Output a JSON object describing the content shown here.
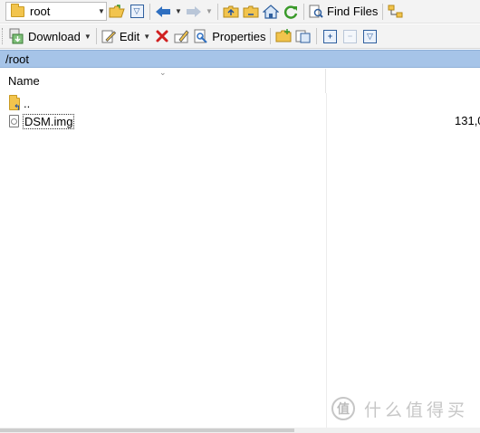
{
  "toolbar1": {
    "location": "root",
    "find_files": "Find Files"
  },
  "toolbar2": {
    "download": "Download",
    "edit": "Edit",
    "properties": "Properties"
  },
  "path": "/root",
  "columns": {
    "name": "Name"
  },
  "rows": [
    {
      "name": "..",
      "type": "parent-folder"
    },
    {
      "name": "DSM.img",
      "size": "131,0",
      "type": "file"
    }
  ],
  "watermark": "值 | 什么值得买",
  "colors": {
    "pathbar": "#a6c4e8",
    "toolbar": "#f3f3f3",
    "folder": "#f2c44d",
    "delete": "#d02020",
    "refresh": "#3a9a2a",
    "accent_blue": "#2f6fc0"
  }
}
